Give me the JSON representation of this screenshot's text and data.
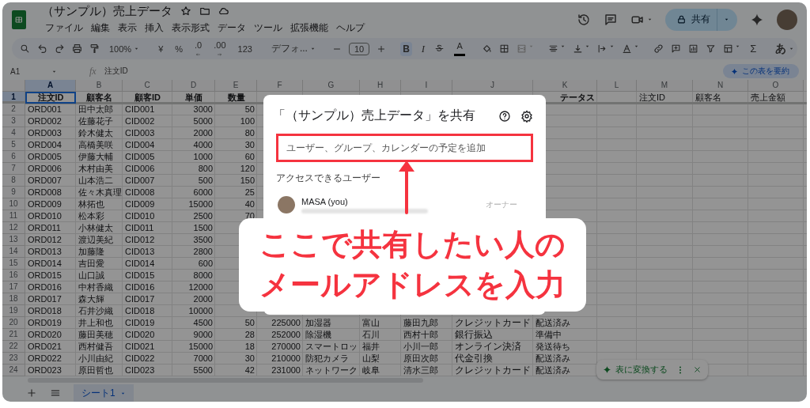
{
  "app": {
    "title": "（サンプル）売上データ",
    "menu": [
      "ファイル",
      "編集",
      "表示",
      "挿入",
      "表示形式",
      "データ",
      "ツール",
      "拡張機能",
      "ヘルプ"
    ],
    "share_button": "共有"
  },
  "toolbar": {
    "zoom": "100%",
    "currency": "¥",
    "percent": "%",
    "decrease_decimal": ".0",
    "increase_decimal": ".00",
    "number_format": "123",
    "font": "デフォ...",
    "font_size": "10",
    "bold": {
      "label": "B",
      "on": true
    },
    "italic": "I",
    "text_color": "A",
    "sum": "Σ",
    "input_tools": "あ"
  },
  "formula_bar": {
    "cell": "A1",
    "label": "fx",
    "content": "注文ID",
    "summarize_button": "この表を要約"
  },
  "sheet": {
    "columns": [
      {
        "letter": "A",
        "selected": true
      },
      {
        "letter": "B",
        "selected": false
      },
      {
        "letter": "C",
        "selected": false
      },
      {
        "letter": "D",
        "selected": false
      },
      {
        "letter": "E",
        "selected": false
      },
      {
        "letter": "F",
        "selected": false
      },
      {
        "letter": "G",
        "selected": false
      },
      {
        "letter": "H",
        "selected": false
      },
      {
        "letter": "I",
        "selected": false
      },
      {
        "letter": "J",
        "selected": false
      },
      {
        "letter": "K",
        "selected": false
      },
      {
        "letter": "L",
        "selected": false
      },
      {
        "letter": "M",
        "selected": false
      },
      {
        "letter": "N",
        "selected": false
      },
      {
        "letter": "O",
        "selected": false
      }
    ],
    "rows": [
      {
        "number": "1",
        "selected": true,
        "cells": [
          "注文ID",
          "顧客名",
          "顧客ID",
          "単価",
          "数量"
        ],
        "column_k": "テータス",
        "columns_m_to_o": [
          "注文ID",
          "顧客名",
          "売上金額"
        ]
      },
      {
        "number": "2",
        "selected": false,
        "cells": [
          "ORD001",
          "田中太郎",
          "CID001",
          "3000",
          "50"
        ]
      },
      {
        "number": "3",
        "selected": false,
        "cells": [
          "ORD002",
          "佐藤花子",
          "CID002",
          "5000",
          "100"
        ]
      },
      {
        "number": "4",
        "selected": false,
        "cells": [
          "ORD003",
          "鈴木健太",
          "CID003",
          "2000",
          "80"
        ]
      },
      {
        "number": "5",
        "selected": false,
        "cells": [
          "ORD004",
          "高橋美咲",
          "CID004",
          "4000",
          "30"
        ]
      },
      {
        "number": "6",
        "selected": false,
        "cells": [
          "ORD005",
          "伊藤大輔",
          "CID005",
          "1000",
          "60"
        ]
      },
      {
        "number": "7",
        "selected": false,
        "cells": [
          "ORD006",
          "木村由美",
          "CID006",
          "800",
          "120"
        ]
      },
      {
        "number": "8",
        "selected": false,
        "cells": [
          "ORD007",
          "山本浩二",
          "CID007",
          "500",
          "150"
        ]
      },
      {
        "number": "9",
        "selected": false,
        "cells": [
          "ORD008",
          "佐々木真理",
          "CID008",
          "6000",
          "25"
        ]
      },
      {
        "number": "10",
        "selected": false,
        "cells": [
          "ORD009",
          "林拓也",
          "CID009",
          "15000",
          "40"
        ]
      },
      {
        "number": "11",
        "selected": false,
        "cells": [
          "ORD010",
          "松本彩",
          "CID010",
          "2500",
          "70"
        ]
      },
      {
        "number": "12",
        "selected": false,
        "cells": [
          "ORD011",
          "小林健太",
          "CID011",
          "1500"
        ]
      },
      {
        "number": "13",
        "selected": false,
        "cells": [
          "ORD012",
          "渡辺美紀",
          "CID012",
          "3500"
        ]
      },
      {
        "number": "14",
        "selected": false,
        "cells": [
          "ORD013",
          "加藤隆",
          "CID013",
          "2800"
        ]
      },
      {
        "number": "15",
        "selected": false,
        "cells": [
          "ORD014",
          "吉田愛",
          "CID014",
          "600"
        ]
      },
      {
        "number": "16",
        "selected": false,
        "cells": [
          "ORD015",
          "山口誠",
          "CID015",
          "8000"
        ]
      },
      {
        "number": "17",
        "selected": false,
        "cells": [
          "ORD016",
          "中村香織",
          "CID016",
          "12000"
        ]
      },
      {
        "number": "18",
        "selected": false,
        "cells": [
          "ORD017",
          "森大輝",
          "CID017",
          "2000"
        ]
      },
      {
        "number": "19",
        "selected": false,
        "cells": [
          "ORD018",
          "石井沙織",
          "CID018",
          "10000"
        ]
      },
      {
        "number": "20",
        "selected": false,
        "cells": [
          "ORD019",
          "井上和也",
          "CID019",
          "4500",
          "50",
          "225000",
          "加湿器",
          "富山",
          "藤田九郎",
          "クレジットカード",
          "配送済み"
        ]
      },
      {
        "number": "21",
        "selected": false,
        "cells": [
          "ORD020",
          "藤田美穂",
          "CID020",
          "9000",
          "28",
          "252000",
          "除湿機",
          "石川",
          "西村十郎",
          "銀行振込",
          "準備中"
        ]
      },
      {
        "number": "22",
        "selected": false,
        "cells": [
          "ORD021",
          "西村健吾",
          "CID021",
          "15000",
          "18",
          "270000",
          "スマートロッ",
          "福井",
          "小川一郎",
          "オンライン決済",
          "発送待ち"
        ]
      },
      {
        "number": "23",
        "selected": false,
        "cells": [
          "ORD022",
          "小川由紀",
          "CID022",
          "7000",
          "30",
          "210000",
          "防犯カメラ",
          "山梨",
          "原田次郎",
          "代金引換",
          "配送済み"
        ]
      },
      {
        "number": "24",
        "selected": false,
        "cells": [
          "ORD023",
          "原田哲也",
          "CID023",
          "5500",
          "42",
          "231000",
          "ネットワーク",
          "岐阜",
          "清水三郎",
          "クレジットカード",
          "配送済み"
        ]
      }
    ]
  },
  "sheet_tabs": [
    {
      "label": "シート1",
      "selected": true
    }
  ],
  "table_chip": {
    "label": "表に変換する"
  },
  "share_dialog": {
    "title": "「（サンプル）売上データ」を共有",
    "placeholder": "ユーザー、グループ、カレンダーの予定を追加",
    "section": "アクセスできるユーザー",
    "users": [
      {
        "name": "MASA (you)",
        "role": "オーナー"
      }
    ]
  },
  "annotation": {
    "lines": [
      "ここで共有したい人の",
      "メールアドレスを入力"
    ]
  }
}
